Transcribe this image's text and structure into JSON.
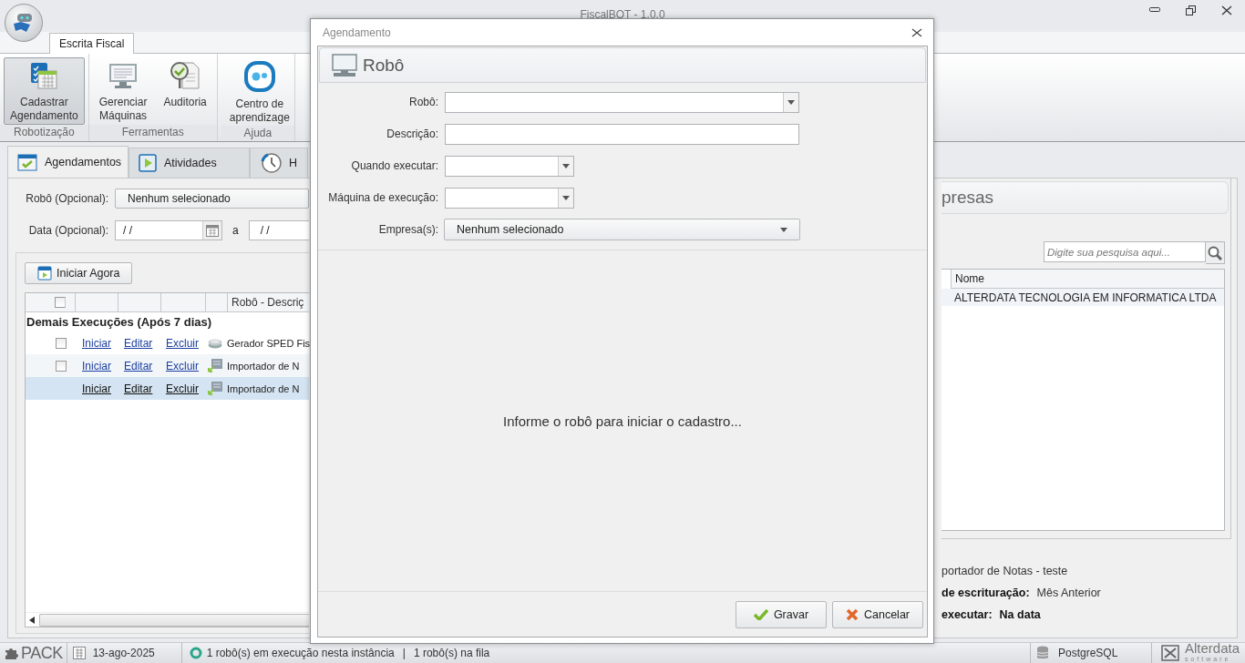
{
  "window": {
    "title": "FiscalBOT - 1.0.0"
  },
  "ribbon": {
    "tabs": [
      {
        "label": "Escrita Fiscal",
        "selected": true
      }
    ],
    "groups": [
      {
        "label": "Robotização",
        "buttons": [
          {
            "label": "Cadastrar\nAgendamento",
            "kind": "schedule",
            "selected": true
          }
        ]
      },
      {
        "label": "Ferramentas",
        "buttons": [
          {
            "label": "Gerenciar\nMáquinas",
            "kind": "monitor",
            "selected": false
          },
          {
            "label": "Auditoria",
            "kind": "audit",
            "selected": false
          }
        ]
      },
      {
        "label": "Ajuda",
        "buttons": [
          {
            "label": "Centro de\naprendizage",
            "kind": "chat",
            "selected": false
          }
        ]
      }
    ]
  },
  "tabs": [
    {
      "label": "Agendamentos",
      "kind": "calendar",
      "selected": true
    },
    {
      "label": "Atividades",
      "kind": "play",
      "selected": false
    },
    {
      "label": "H",
      "kind": "clock",
      "selected": false
    }
  ],
  "filters": {
    "robot": {
      "label": "Robô (Opcional):",
      "value": "Nenhum selecionado"
    },
    "date": {
      "label": "Data (Opcional):",
      "from": "/ /",
      "separator": "a",
      "to": "/ /"
    }
  },
  "start_button": "Iniciar Agora",
  "grid": {
    "header_checked": false,
    "columns": [
      "Robô - Descriç"
    ],
    "group": "Demais Execuções (Após 7 dias)",
    "rows": [
      {
        "checked": false,
        "selected": false,
        "actions": [
          "Iniciar",
          "Editar",
          "Excluir"
        ],
        "kind": "disk",
        "robot": "Gerador SPED Fis"
      },
      {
        "checked": false,
        "selected": false,
        "actions": [
          "Iniciar",
          "Editar",
          "Excluir"
        ],
        "kind": "nfe",
        "robot": "Importador de N"
      },
      {
        "selected": true,
        "actions": [
          "Iniciar",
          "Editar",
          "Excluir"
        ],
        "kind": "nfe",
        "robot": "Importador de N"
      }
    ]
  },
  "companies": {
    "header": "presas",
    "search": {
      "placeholder": "Digite sua pesquisa aqui..."
    },
    "columns": [
      "Nome"
    ],
    "rows": [
      {
        "name": "ALTERDATA TECNOLOGIA EM INFORMATICA LTDA"
      }
    ]
  },
  "details": [
    {
      "value": "portador de Notas - teste",
      "strong": false
    },
    {
      "label": "de escrituração:",
      "value": "Mês Anterior",
      "strong": false
    },
    {
      "label": "executar:",
      "value": "Na data",
      "strong": true
    }
  ],
  "dialog": {
    "title": "Agendamento",
    "header": "Robô",
    "fields": [
      {
        "label": "Robô:",
        "kind": "combo"
      },
      {
        "label": "Descrição:",
        "kind": "text"
      },
      {
        "label": "Quando executar:",
        "kind": "short_combo"
      },
      {
        "label": "Máquina de execução:",
        "kind": "short_combo"
      },
      {
        "label": "Empresa(s):",
        "kind": "dropdown",
        "value": "Nenhum selecionado"
      }
    ],
    "message": "Informe o robô para iniciar o cadastro...",
    "buttons": [
      {
        "label": "Gravar",
        "kind": "ok"
      },
      {
        "label": "Cancelar",
        "kind": "cancel"
      }
    ]
  },
  "status_bar": {
    "pack": "PACK",
    "date": "13-ago-2025",
    "running": "1 robô(s) em execução nesta instância",
    "separator": "|",
    "queue": "1 robô(s) na fila",
    "database": "PostgreSQL",
    "brand": "Alterdata",
    "brand_sub": "software"
  }
}
